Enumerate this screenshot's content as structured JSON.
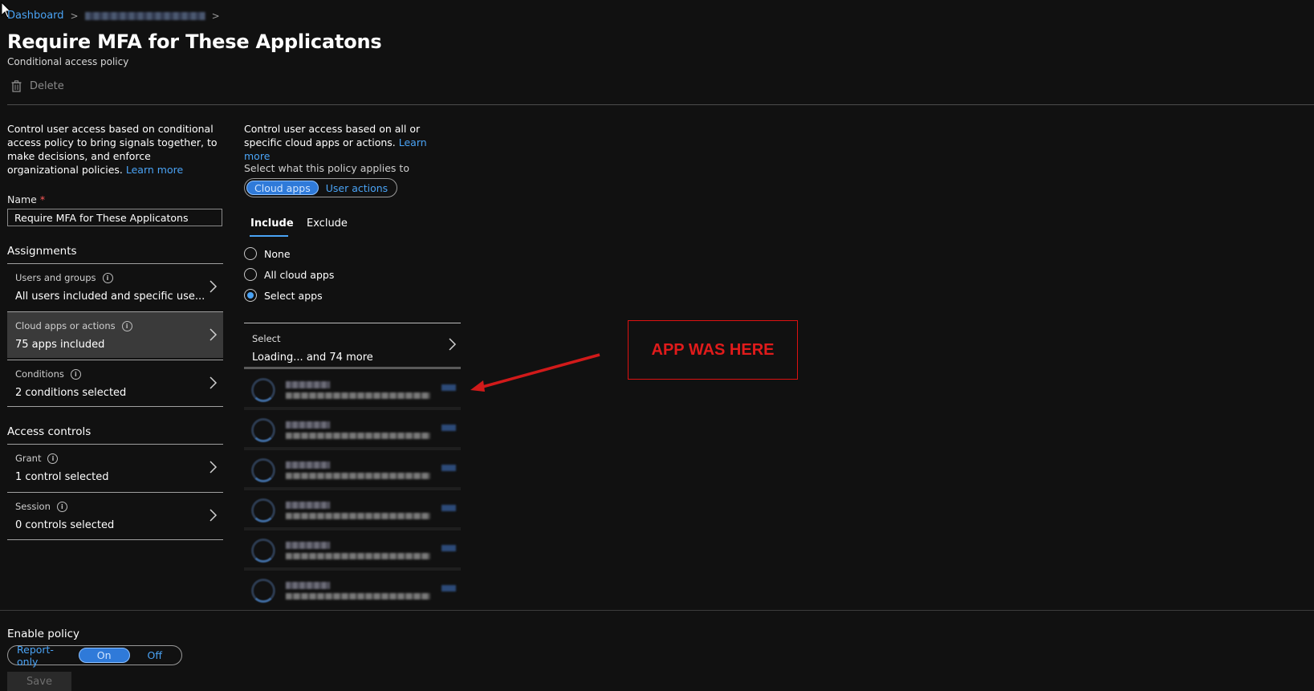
{
  "breadcrumb": {
    "home": "Dashboard"
  },
  "header": {
    "title": "Require MFA for These Applicatons",
    "subtitle": "Conditional access policy",
    "delete_label": "Delete"
  },
  "left": {
    "description": "Control user access based on conditional access policy to bring signals together, to make decisions, and enforce organizational policies.",
    "learn_more": "Learn more",
    "name_label": "Name",
    "name_required": "*",
    "name_value": "Require MFA for These Applicatons",
    "assignments_heading": "Assignments",
    "assignments": [
      {
        "title": "Users and groups",
        "value": "All users included and specific use..."
      },
      {
        "title": "Cloud apps or actions",
        "value": "75 apps included"
      },
      {
        "title": "Conditions",
        "value": "2 conditions selected"
      }
    ],
    "access_heading": "Access controls",
    "access": [
      {
        "title": "Grant",
        "value": "1 control selected"
      },
      {
        "title": "Session",
        "value": "0 controls selected"
      }
    ]
  },
  "right": {
    "description": "Control user access based on all or specific cloud apps or actions.",
    "learn_more": "Learn more",
    "applies_label": "Select what this policy applies to",
    "applies_options": [
      "Cloud apps",
      "User actions"
    ],
    "applies_selected": "Cloud apps",
    "tabs": [
      "Include",
      "Exclude"
    ],
    "active_tab": "Include",
    "radios": [
      {
        "label": "None",
        "checked": false
      },
      {
        "label": "All cloud apps",
        "checked": false
      },
      {
        "label": "Select apps",
        "checked": true
      }
    ],
    "select_label": "Select",
    "select_value": "Loading... and 74 more"
  },
  "annotation": {
    "text": "APP WAS HERE",
    "color": "#e01b1b"
  },
  "footer": {
    "enable_label": "Enable policy",
    "options": [
      "Report-only",
      "On",
      "Off"
    ],
    "selected": "On",
    "save_label": "Save"
  },
  "colors": {
    "background": "#111111",
    "accent": "#4aa3f5",
    "toggle_on": "#2f7ad9"
  }
}
